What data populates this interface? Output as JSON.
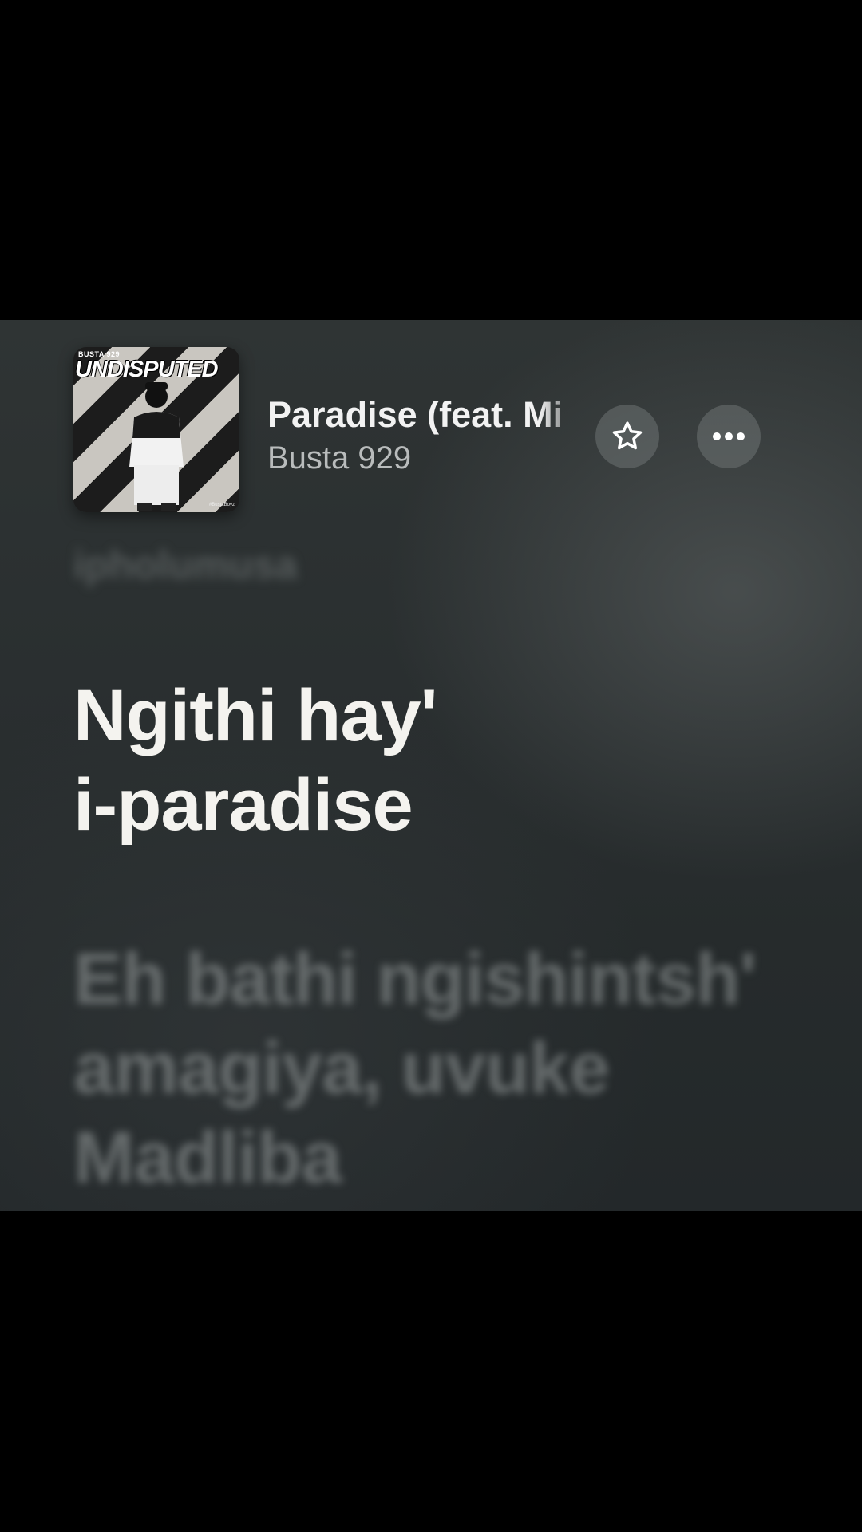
{
  "now_playing": {
    "album_art": {
      "brand_text": "BUSTA 929",
      "title_text": "UNDISPUTED",
      "signature_text": "#BustaBoyz"
    },
    "title": "Paradise (feat. Mi",
    "artist": "Busta 929"
  },
  "actions": {
    "favorite_icon": "star-outline-icon",
    "more_icon": "ellipsis-icon"
  },
  "lyrics": {
    "previous_line": "ipholumusa",
    "current_lines": [
      "Ngithi hay'",
      "i-paradise"
    ],
    "next_lines": [
      "Eh bathi ngishintsh'",
      "amagiya, uvuke",
      "Madliba"
    ]
  },
  "colors": {
    "background_top": "#2f3434",
    "background_bottom": "#23282a",
    "lyric_active": "#f4f3ef",
    "artist_text": "#b9bcbc"
  }
}
